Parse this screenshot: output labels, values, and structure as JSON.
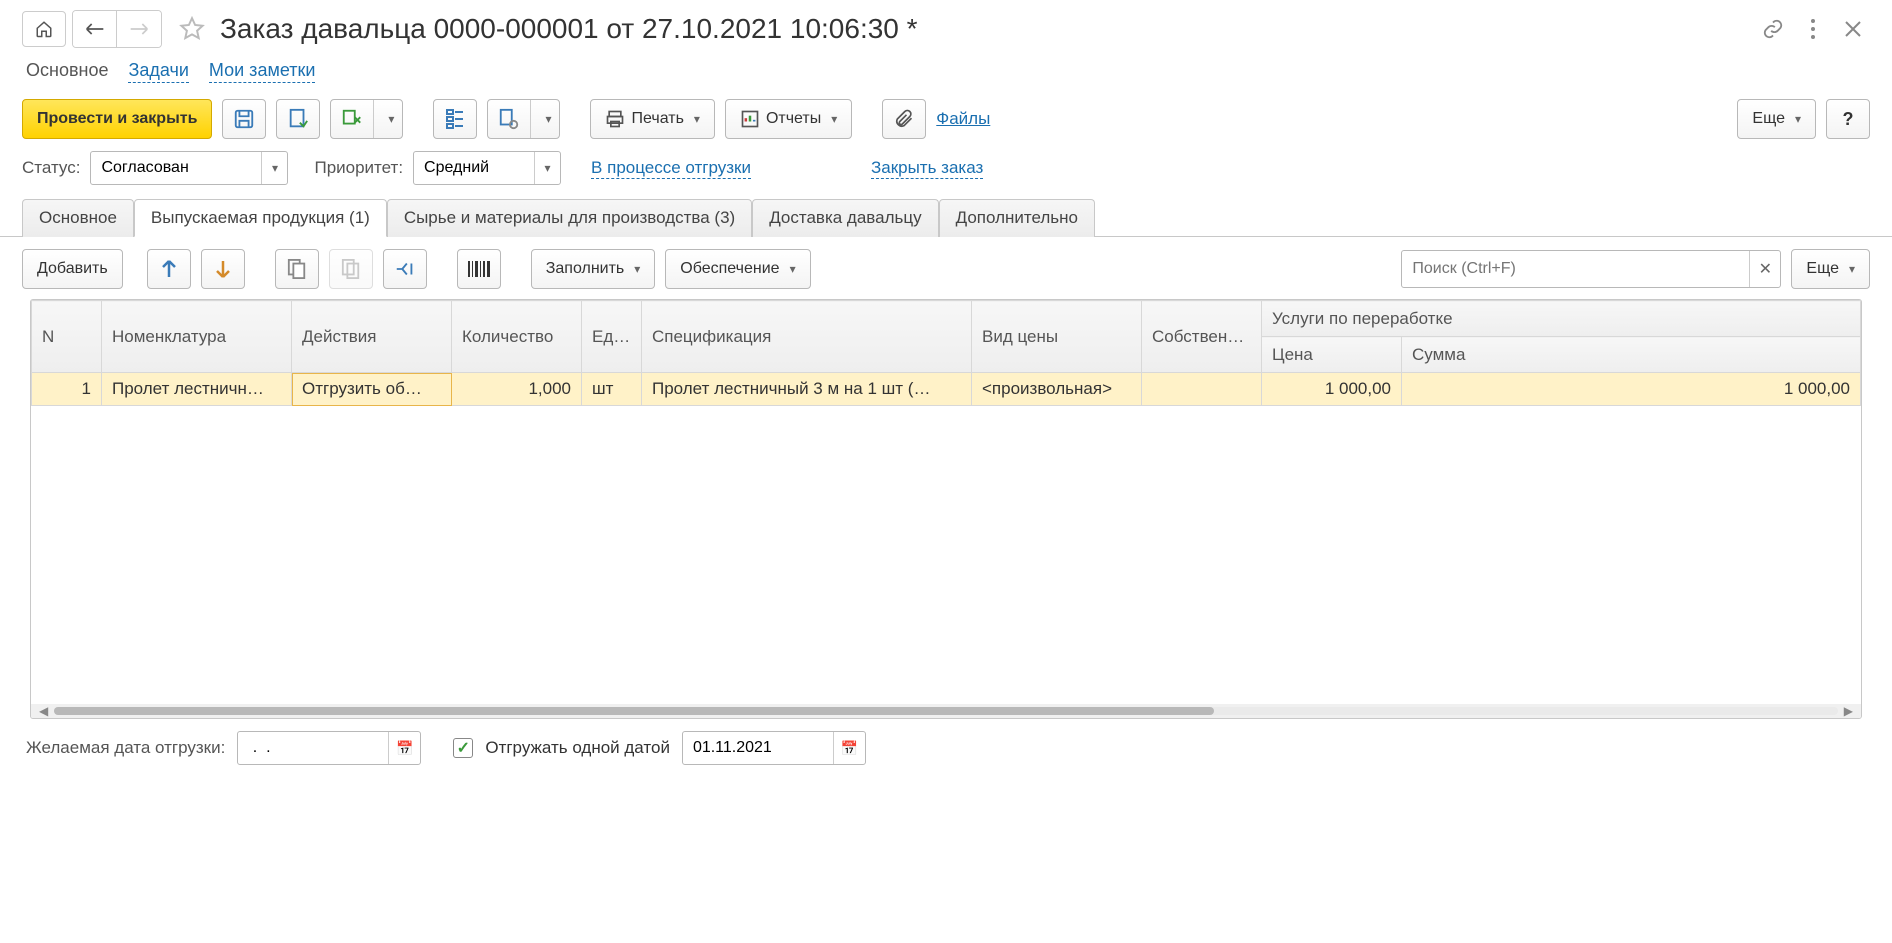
{
  "header": {
    "title": "Заказ давальца 0000-000001 от 27.10.2021 10:06:30 *"
  },
  "section_tabs": {
    "main": "Основное",
    "tasks": "Задачи",
    "notes": "Мои заметки"
  },
  "cmd": {
    "post_close": "Провести и закрыть",
    "print": "Печать",
    "reports": "Отчеты",
    "files": "Файлы",
    "more": "Еще",
    "help": "?"
  },
  "status": {
    "status_label": "Статус:",
    "status_value": "Согласован",
    "priority_label": "Приоритет:",
    "priority_value": "Средний",
    "shipping_link": "В процессе отгрузки",
    "close_link": "Закрыть заказ"
  },
  "tabs": {
    "t0": "Основное",
    "t1": "Выпускаемая продукция (1)",
    "t2": "Сырье и материалы для производства (3)",
    "t3": "Доставка давальцу",
    "t4": "Дополнительно"
  },
  "tbar": {
    "add": "Добавить",
    "fill": "Заполнить",
    "provision": "Обеспечение",
    "search_placeholder": "Поиск (Ctrl+F)",
    "more": "Еще"
  },
  "grid": {
    "h_n": "N",
    "h_nom": "Номенклатура",
    "h_act": "Действия",
    "h_qty": "Количество",
    "h_unit": "Ед. изм.",
    "h_spec": "Спецификация",
    "h_ptype": "Вид цены",
    "h_own": "Собственн материалы",
    "h_svc": "Услуги по переработке",
    "h_price": "Цена",
    "h_sum": "Сумма",
    "rows": [
      {
        "n": "1",
        "nom": "Пролет лестничн…",
        "act": "Отгрузить об…",
        "qty": "1,000",
        "unit": "шт",
        "spec": "Пролет лестничный 3 м на 1 шт (…",
        "ptype": "<произвольная>",
        "own": "",
        "price": "1 000,00",
        "sum": "1 000,00"
      }
    ]
  },
  "bottom": {
    "date_label": "Желаемая дата отгрузки:",
    "date_value": " .  .",
    "single_label": "Отгружать одной датой",
    "single_date": "01.11.2021"
  }
}
